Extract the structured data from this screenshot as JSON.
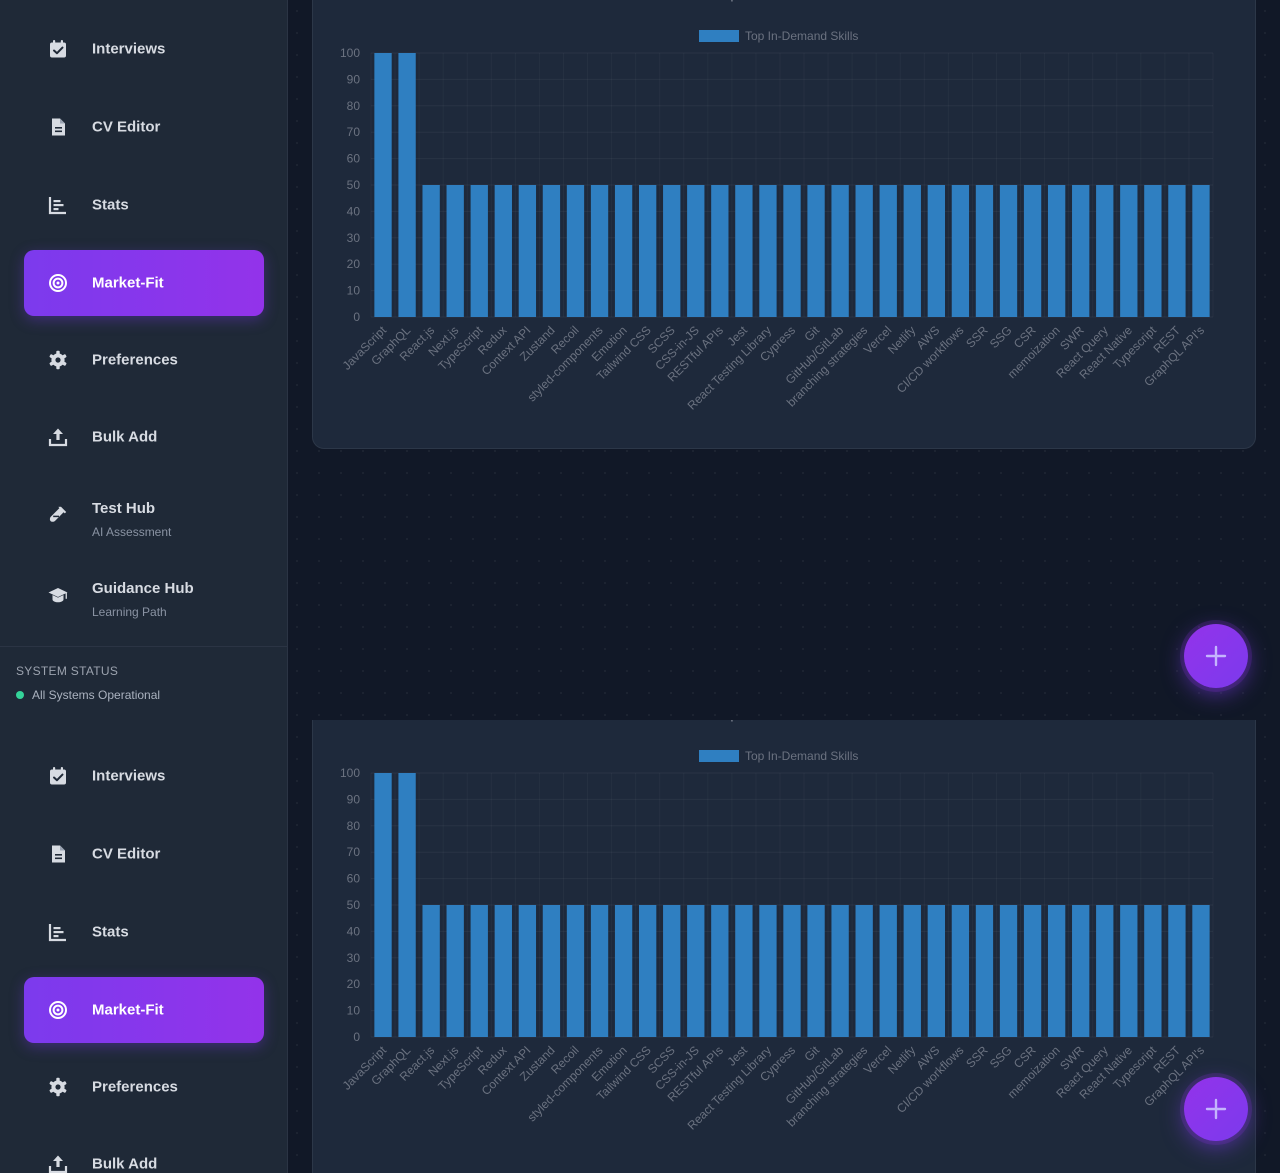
{
  "sidebar": {
    "items": [
      {
        "label": "Interviews",
        "icon": "calendar-check-icon"
      },
      {
        "label": "CV Editor",
        "icon": "document-icon"
      },
      {
        "label": "Stats",
        "icon": "bar-chart-icon"
      },
      {
        "label": "Market-Fit",
        "icon": "target-icon"
      },
      {
        "label": "Preferences",
        "icon": "gear-icon"
      },
      {
        "label": "Bulk Add",
        "icon": "upload-icon"
      },
      {
        "label": "Test Hub",
        "sub": "AI Assessment",
        "icon": "flask-icon"
      },
      {
        "label": "Guidance Hub",
        "sub": "Learning Path",
        "icon": "graduation-cap-icon"
      }
    ],
    "active": "Market-Fit"
  },
  "status": {
    "title": "SYSTEM STATUS",
    "text": "All Systems Operational",
    "dot_color": "#34d399"
  },
  "colors": {
    "accent": "#7c3aed",
    "bar": "#2f7fc1",
    "background": "#111827",
    "card": "#1e293b"
  },
  "fab": {
    "icon": "plus-icon"
  },
  "chart_data": {
    "type": "bar",
    "title": "Top In-Demand Skills",
    "legend": "Top In-Demand Skills",
    "legend_position": "top",
    "categories": [
      "JavaScript",
      "GraphQL",
      "React.js",
      "Next.js",
      "TypeScript",
      "Redux",
      "Context API",
      "Zustand",
      "Recoil",
      "styled-components",
      "Emotion",
      "Tailwind CSS",
      "SCSS",
      "CSS-in-JS",
      "RESTful APIs",
      "Jest",
      "React Testing Library",
      "Cypress",
      "Git",
      "GitHub/GitLab",
      "branching strategies",
      "Vercel",
      "Netlify",
      "AWS",
      "CI/CD workflows",
      "SSR",
      "SSG",
      "CSR",
      "memoization",
      "SWR",
      "React Query",
      "React Native",
      "Typescript",
      "REST",
      "GraphQL API's"
    ],
    "values": [
      100,
      100,
      50,
      50,
      50,
      50,
      50,
      50,
      50,
      50,
      50,
      50,
      50,
      50,
      50,
      50,
      50,
      50,
      50,
      50,
      50,
      50,
      50,
      50,
      50,
      50,
      50,
      50,
      50,
      50,
      50,
      50,
      50,
      50,
      50
    ],
    "yticks": [
      "0",
      "10",
      "20",
      "30",
      "40",
      "50",
      "60",
      "70",
      "80",
      "90",
      "100"
    ],
    "ylim": [
      0,
      100
    ],
    "grid": true
  }
}
